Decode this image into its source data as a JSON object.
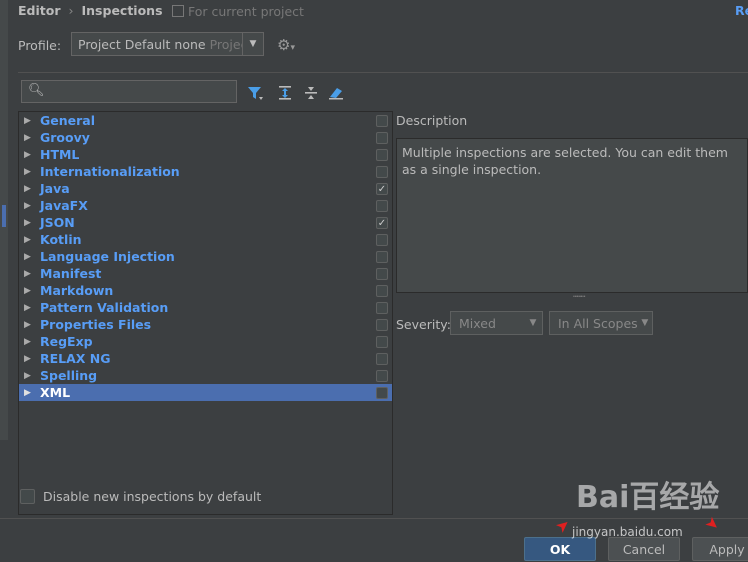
{
  "breadcrumb": {
    "root": "Editor",
    "sep": "›",
    "current": "Inspections",
    "note": "For current project",
    "reset": "Re"
  },
  "profile": {
    "label": "Profile:",
    "value": "Project Default",
    "value_dim": "none",
    "value_tail": "Projec"
  },
  "tree": {
    "items": [
      {
        "label": "General",
        "checked": ""
      },
      {
        "label": "Groovy",
        "checked": ""
      },
      {
        "label": "HTML",
        "checked": ""
      },
      {
        "label": "Internationalization",
        "checked": ""
      },
      {
        "label": "Java",
        "checked": "✓"
      },
      {
        "label": "JavaFX",
        "checked": ""
      },
      {
        "label": "JSON",
        "checked": "✓"
      },
      {
        "label": "Kotlin",
        "checked": ""
      },
      {
        "label": "Language Injection",
        "checked": ""
      },
      {
        "label": "Manifest",
        "checked": ""
      },
      {
        "label": "Markdown",
        "checked": ""
      },
      {
        "label": "Pattern Validation",
        "checked": ""
      },
      {
        "label": "Properties Files",
        "checked": ""
      },
      {
        "label": "RegExp",
        "checked": ""
      },
      {
        "label": "RELAX NG",
        "checked": ""
      },
      {
        "label": "Spelling",
        "checked": ""
      },
      {
        "label": "XML",
        "checked": "",
        "selected": true
      }
    ]
  },
  "description": {
    "title": "Description",
    "text": "Multiple inspections are selected. You can edit them as a single inspection."
  },
  "severity": {
    "label": "Severity:",
    "value": "Mixed",
    "scope": "In All Scopes"
  },
  "disable_label": "Disable new inspections by default",
  "buttons": {
    "ok": "OK",
    "cancel": "Cancel",
    "apply": "Apply"
  },
  "watermark": {
    "brand": "Bai百经验",
    "url": "jingyan.baidu.com"
  },
  "colors": {
    "accent": "#589df6",
    "selection": "#4b6eaf",
    "background": "#3c3f41"
  }
}
